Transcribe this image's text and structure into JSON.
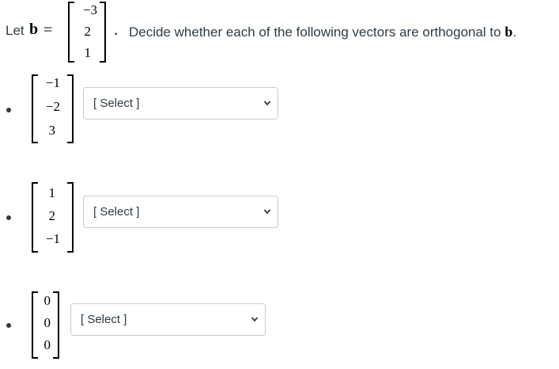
{
  "header": {
    "let_label": "Let",
    "vector_name": "b",
    "equals": "=",
    "vector_b": [
      "−3",
      "2",
      "1"
    ],
    "period": ".",
    "instruction": "Decide whether each of the following vectors are orthogonal to",
    "instruction_vector": "b",
    "instruction_end": "."
  },
  "questions": [
    {
      "vector": [
        "−1",
        "−2",
        "3"
      ],
      "select_value": "[ Select ]"
    },
    {
      "vector": [
        "1",
        "2",
        "−1"
      ],
      "select_value": "[ Select ]"
    },
    {
      "vector": [
        "0",
        "0",
        "0"
      ],
      "select_value": "[ Select ]"
    }
  ],
  "icons": {
    "dropdown": "chevron-down-icon",
    "bullet": "bullet-icon"
  }
}
